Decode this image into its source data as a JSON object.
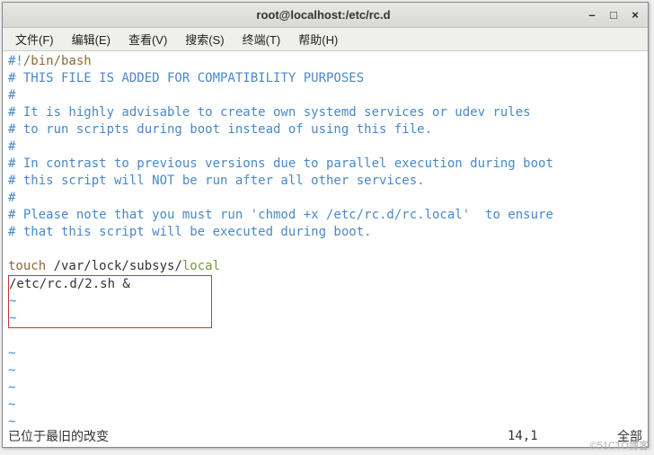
{
  "window": {
    "title": "root@localhost:/etc/rc.d"
  },
  "menubar": {
    "items": [
      "文件(F)",
      "编辑(E)",
      "查看(V)",
      "搜索(S)",
      "终端(T)",
      "帮助(H)"
    ]
  },
  "editor": {
    "shebang_hash": "#!",
    "shebang_path": "/bin/bash",
    "comments": [
      "# THIS FILE IS ADDED FOR COMPATIBILITY PURPOSES",
      "#",
      "# It is highly advisable to create own systemd services or udev rules",
      "# to run scripts during boot instead of using this file.",
      "#",
      "# In contrast to previous versions due to parallel execution during boot",
      "# this script will NOT be run after all other services.",
      "#",
      "# Please note that you must run 'chmod +x /etc/rc.d/rc.local'  to ensure",
      "# that this script will be executed during boot."
    ],
    "touch_cmd": "touch ",
    "touch_path_pre": "/var/lock/subsys/",
    "touch_path_last": "local",
    "userline": "/etc/rc.d/2.sh &",
    "tilde": "~"
  },
  "status": {
    "message": "已位于最旧的改变",
    "position": "14,1",
    "mode": "全部"
  },
  "watermark": "©51CTO博客"
}
